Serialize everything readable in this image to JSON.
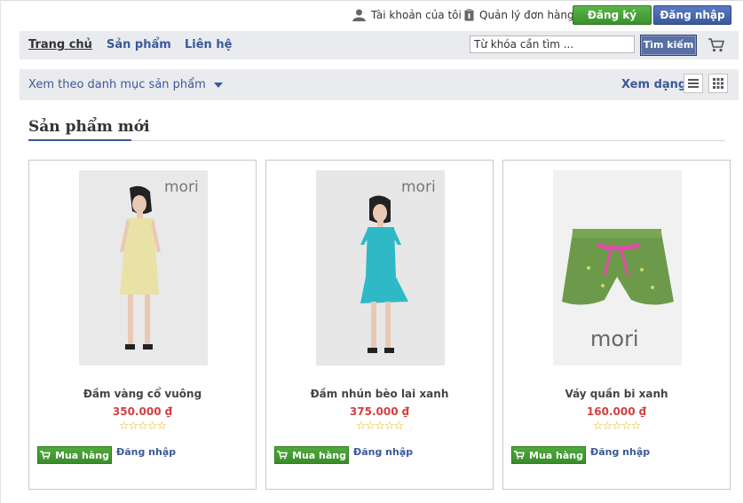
{
  "topbar": {
    "account": "Tài khoản của tôi",
    "orders": "Quản lý đơn hàng",
    "register": "Đăng ký",
    "login": "Đăng nhập"
  },
  "nav": {
    "items": [
      "Trang chủ",
      "Sản phẩm",
      "Liên hệ"
    ],
    "search_value": "Từ khóa cần tìm ...",
    "search_button": "Tìm kiếm"
  },
  "category": {
    "label": "Xem theo danh mục sản phẩm",
    "view_label": "Xem dạng:"
  },
  "section": {
    "title": "Sản phẩm mới"
  },
  "products": [
    {
      "name": "Đầm vàng cổ vuông",
      "price": "350.000 ₫",
      "stars": "☆☆☆☆☆",
      "buy": "Mua hàng",
      "login": "Đăng nhập",
      "brand": "mori"
    },
    {
      "name": "Đầm nhún bèo lai xanh",
      "price": "375.000 ₫",
      "stars": "☆☆☆☆☆",
      "buy": "Mua hàng",
      "login": "Đăng nhập",
      "brand": "mori"
    },
    {
      "name": "Váy quần bi xanh",
      "price": "160.000 ₫",
      "stars": "☆☆☆☆☆",
      "buy": "Mua hàng",
      "login": "Đăng nhập",
      "brand": "mori"
    }
  ],
  "colors": {
    "brand_blue": "#3b5998",
    "green": "#4faa3b",
    "price_red": "#d24040"
  }
}
